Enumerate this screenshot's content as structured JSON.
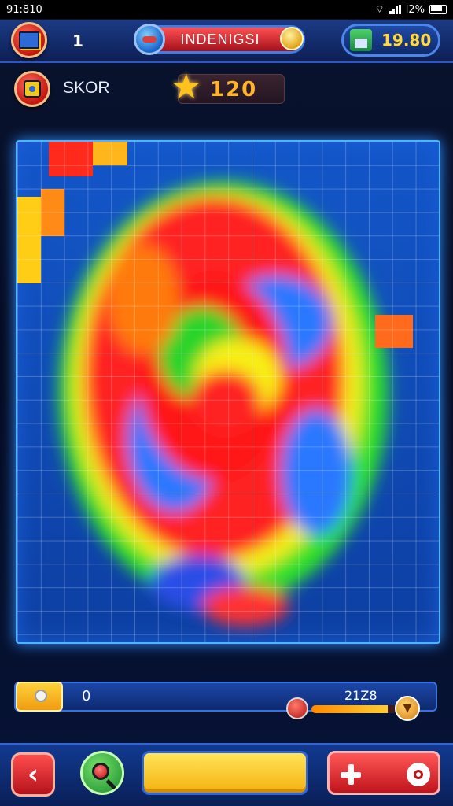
{
  "status_bar": {
    "time": "91:810",
    "battery": "l2%"
  },
  "header": {
    "level": "1",
    "title": "INDENIGSI",
    "coins": "19.80"
  },
  "score": {
    "label": "SKOR",
    "value": "120"
  },
  "progress": {
    "left_value": "0",
    "right_value": "21Z8",
    "fill": 0.88
  },
  "icons": [
    "book-icon",
    "globe-icon",
    "gem-icon",
    "home-icon",
    "target-icon",
    "star-icon",
    "back-arrow-icon",
    "magnifier-icon",
    "plus-icon",
    "ring-icon"
  ],
  "colors": {
    "accent": "#2f8fff",
    "danger": "#d7191f",
    "gold": "#ffc21c"
  }
}
